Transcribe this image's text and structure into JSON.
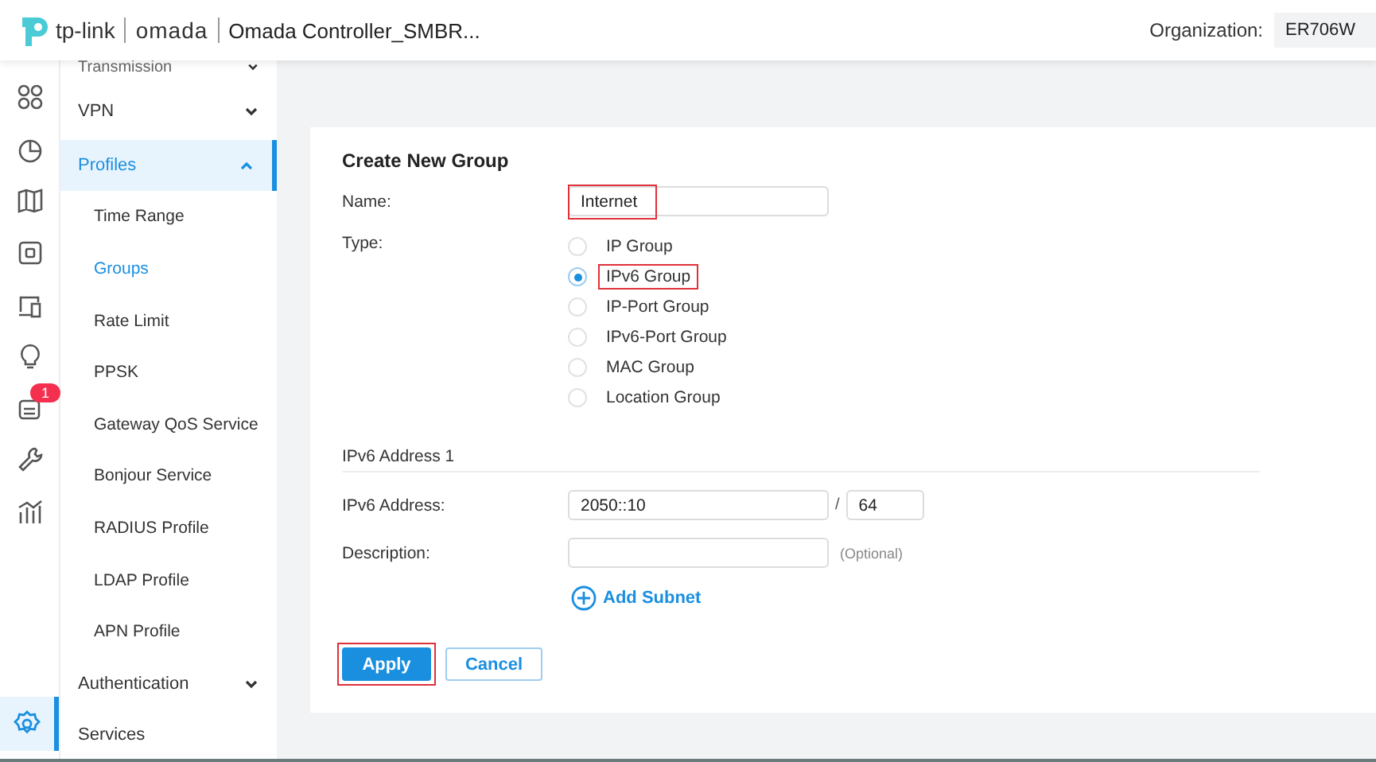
{
  "header": {
    "brand": "tp-link",
    "product": "omada",
    "title": "Omada Controller_SMBR...",
    "org_label": "Organization:",
    "org_value": "ER706W"
  },
  "rail": [
    {
      "selected": false
    },
    {
      "selected": false
    },
    {
      "selected": false
    },
    {
      "selected": false
    },
    {
      "selected": false
    },
    {
      "selected": false
    },
    {
      "selected": false,
      "badge": "1"
    },
    {
      "selected": false
    },
    {
      "selected": false
    },
    {
      "selected": true
    }
  ],
  "menu": [
    {
      "label": "Transmission",
      "kind": "group",
      "expanded": false,
      "active": false
    },
    {
      "label": "VPN",
      "kind": "group",
      "expanded": false,
      "active": false
    },
    {
      "label": "Profiles",
      "kind": "group",
      "expanded": true,
      "active": true,
      "children": [
        {
          "label": "Time Range",
          "selected": false
        },
        {
          "label": "Groups",
          "selected": true
        },
        {
          "label": "Rate Limit",
          "selected": false
        },
        {
          "label": "PPSK",
          "selected": false
        },
        {
          "label": "Gateway QoS Service",
          "selected": false
        },
        {
          "label": "Bonjour Service",
          "selected": false
        },
        {
          "label": "RADIUS Profile",
          "selected": false
        },
        {
          "label": "LDAP Profile",
          "selected": false
        },
        {
          "label": "APN Profile",
          "selected": false
        }
      ]
    },
    {
      "label": "Authentication",
      "kind": "group",
      "expanded": false,
      "active": false
    },
    {
      "label": "Services",
      "kind": "link",
      "active": false
    }
  ],
  "form": {
    "title": "Create New Group",
    "name": {
      "label": "Name:",
      "value": "Internet",
      "highlighted": true
    },
    "type": {
      "label": "Type:",
      "options": [
        {
          "label": "IP Group",
          "selected": false,
          "highlighted": false
        },
        {
          "label": "IPv6 Group",
          "selected": true,
          "highlighted": true
        },
        {
          "label": "IP-Port Group",
          "selected": false,
          "highlighted": false
        },
        {
          "label": "IPv6-Port Group",
          "selected": false,
          "highlighted": false
        },
        {
          "label": "MAC Group",
          "selected": false,
          "highlighted": false
        },
        {
          "label": "Location Group",
          "selected": false,
          "highlighted": false
        }
      ]
    },
    "section": "IPv6 Address 1",
    "address": {
      "label": "IPv6 Address:",
      "value": "2050::10",
      "separator": "/",
      "prefix": "64"
    },
    "description": {
      "label": "Description:",
      "hint": "(Optional)"
    },
    "add_subnet": "Add Subnet",
    "buttons": [
      {
        "label": "Apply",
        "kind": "primary",
        "highlighted": true
      },
      {
        "label": "Cancel",
        "kind": "secondary",
        "highlighted": false
      }
    ]
  }
}
